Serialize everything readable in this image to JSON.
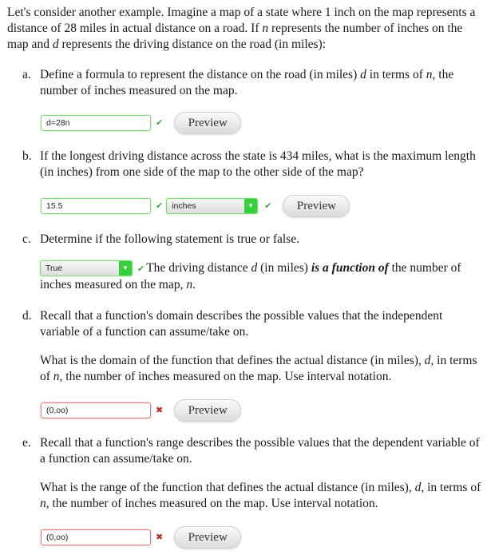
{
  "intro": {
    "p1": "Let's consider another example. Imagine a map of a state where 1 inch on the map represents a distance of 28 miles in actual distance on a road. If ",
    "var_n": "n",
    "p2": " represents the number of inches on the map and ",
    "var_d": "d",
    "p3": " represents the driving distance on the road (in miles):"
  },
  "parts": {
    "a": {
      "label": "a.",
      "q1": "Define a formula to represent the distance on the road (in miles) ",
      "var_d": "d",
      "q2": " in terms of ",
      "var_n": "n",
      "q3": ", the number of inches measured on the map.",
      "answer": "d=28n",
      "status": "correct",
      "check_icon": "✔",
      "preview_label": "Preview"
    },
    "b": {
      "label": "b.",
      "question": "If the longest driving distance across the state is 434 miles, what is the maximum length (in inches) from one side of the map to the other side of the map?",
      "answer": "15.5",
      "status": "correct",
      "check_icon": "✔",
      "unit_selected": "inches",
      "unit_status": "correct",
      "dropdown_icon": "▼",
      "preview_label": "Preview"
    },
    "c": {
      "label": "c.",
      "question": "Determine if the following statement is true or false.",
      "selected": "True",
      "status": "correct",
      "check_icon": "✔",
      "dropdown_icon": "▼",
      "s1": "The driving distance ",
      "var_d": "d",
      "s2": " (in miles) ",
      "emph": "is a function of",
      "s3": " the number of inches measured on the map, ",
      "var_n": "n",
      "s4": "."
    },
    "d": {
      "label": "d.",
      "intro": "Recall that a function's domain describes the possible values that the independent variable of a function can assume/take on.",
      "q1": "What is the domain of the function that defines the actual distance (in miles), ",
      "var_d": "d",
      "q2": ", in terms of ",
      "var_n": "n",
      "q3": ", the number of inches measured on the map. Use interval notation.",
      "answer": "(0,oo)",
      "status": "incorrect",
      "cross_icon": "✖",
      "preview_label": "Preview"
    },
    "e": {
      "label": "e.",
      "intro": "Recall that a function's range describes the possible values that the dependent variable of a function can assume/take on.",
      "q1": "What is the range of the function that defines the actual distance (in miles), ",
      "var_d": "d",
      "q2": ", in terms of ",
      "var_n": "n",
      "q3": ", the number of inches measured on the map. Use interval notation.",
      "answer": "(0,oo)",
      "status": "incorrect",
      "cross_icon": "✖",
      "preview_label": "Preview"
    }
  },
  "colors": {
    "correct": "#3fa83a",
    "incorrect": "#c0282a",
    "dropdown_accent": "#35d13a"
  }
}
